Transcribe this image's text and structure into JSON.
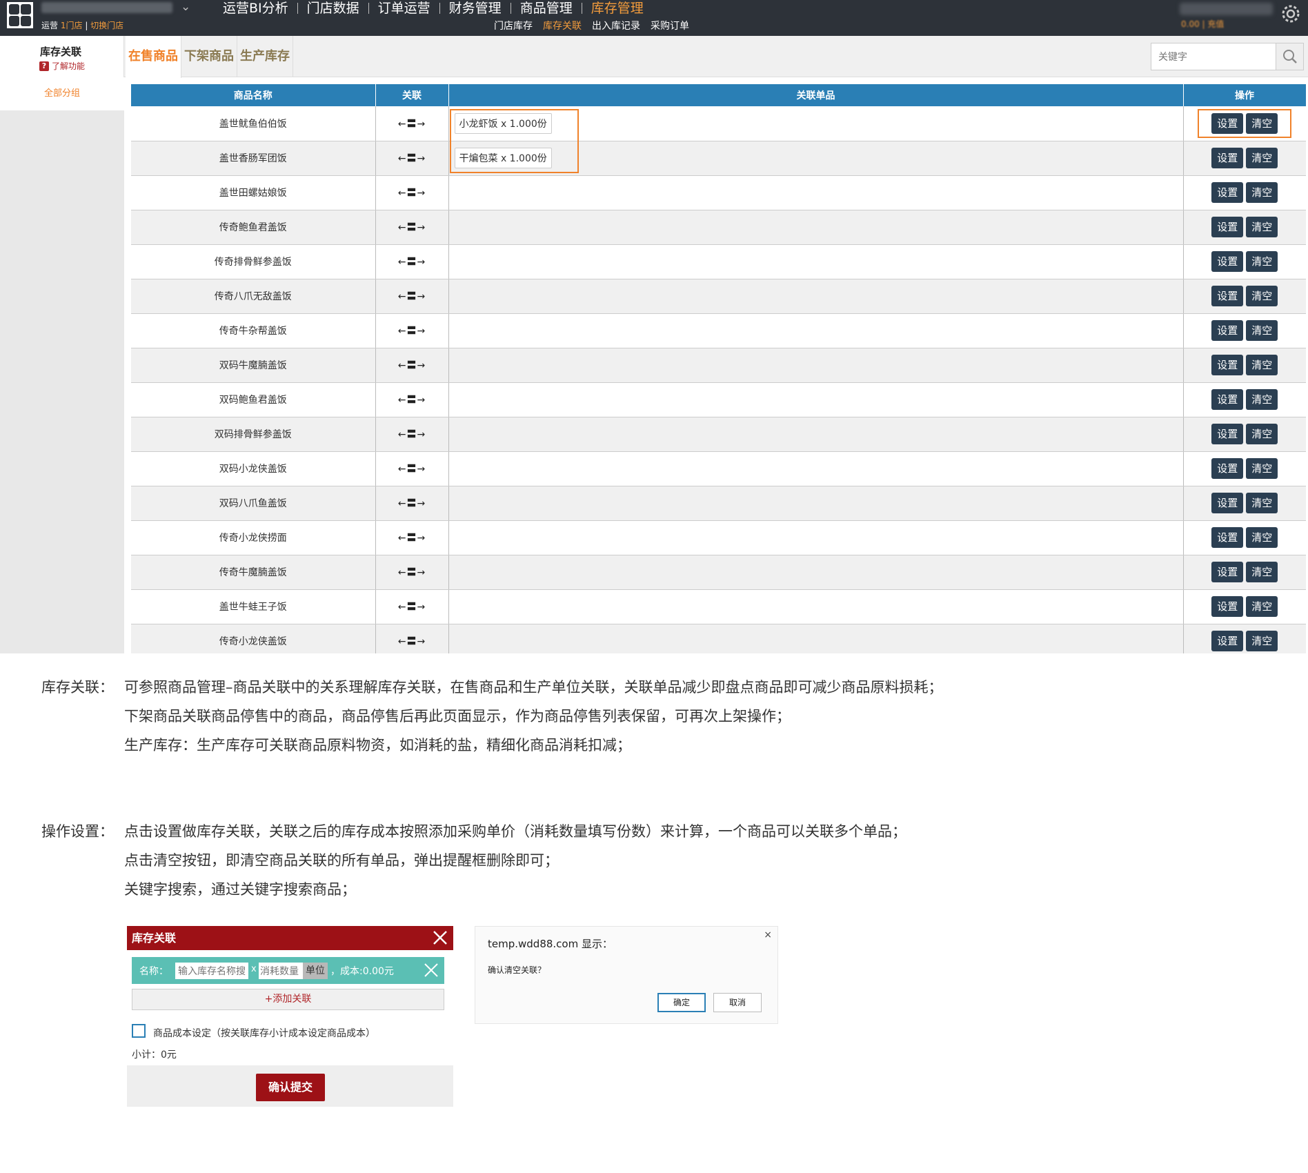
{
  "header": {
    "store_sub": "运营",
    "store_count": "1门店",
    "store_switch": "切换门店",
    "nav": [
      "运营BI分析",
      "门店数据",
      "订单运营",
      "财务管理",
      "商品管理",
      "库存管理"
    ],
    "nav_active": 5,
    "subnav": [
      "门店库存",
      "库存关联",
      "出入库记录",
      "采购订单"
    ],
    "subnav_active": 1,
    "user_sub": "0.00 | 充值"
  },
  "sidebar": {
    "title": "库存关联",
    "help": "了解功能",
    "all_groups": "全部分组"
  },
  "tabs": [
    "在售商品",
    "下架商品",
    "生产库存"
  ],
  "search": {
    "placeholder": "关键字"
  },
  "table": {
    "headers": [
      "商品名称",
      "关联",
      "关联单品",
      "操作"
    ],
    "link_symbol": "←〓→",
    "btn_set": "设置",
    "btn_clear": "清空",
    "rows": [
      {
        "name": "盖世鱿鱼伯伯饭",
        "items": [
          "小龙虾饭 x 1.000份"
        ]
      },
      {
        "name": "盖世香肠军团饭",
        "items": [
          "干煸包菜 x 1.000份"
        ]
      },
      {
        "name": "盖世田螺姑娘饭",
        "items": []
      },
      {
        "name": "传奇鲍鱼君盖饭",
        "items": []
      },
      {
        "name": "传奇排骨鲜参盖饭",
        "items": []
      },
      {
        "name": "传奇八爪无敌盖饭",
        "items": []
      },
      {
        "name": "传奇牛杂帮盖饭",
        "items": []
      },
      {
        "name": "双码牛魔腩盖饭",
        "items": []
      },
      {
        "name": "双码鲍鱼君盖饭",
        "items": []
      },
      {
        "name": "双码排骨鲜参盖饭",
        "items": []
      },
      {
        "name": "双码小龙侠盖饭",
        "items": []
      },
      {
        "name": "双码八爪鱼盖饭",
        "items": []
      },
      {
        "name": "传奇小龙侠捞面",
        "items": []
      },
      {
        "name": "传奇牛魔腩盖饭",
        "items": []
      },
      {
        "name": "盖世牛蛙王子饭",
        "items": []
      },
      {
        "name": "传奇小龙侠盖饭",
        "items": []
      }
    ]
  },
  "notes": {
    "n1_label": "库存关联：",
    "n1_l1": "可参照商品管理–商品关联中的关系理解库存关联，在售商品和生产单位关联，关联单品减少即盘点商品即可减少商品原料损耗；",
    "n1_l2": "下架商品关联商品停售中的商品，商品停售后再此页面显示，作为商品停售列表保留，可再次上架操作；",
    "n1_l3": "生产库存：生产库存可关联商品原料物资，如消耗的盐，精细化商品消耗扣减；",
    "n2_label": "操作设置：",
    "n2_l1": "点击设置做库存关联，关联之后的库存成本按照添加采购单价（消耗数量填写份数）来计算，一个商品可以关联多个单品；",
    "n2_l2": "点击清空按钮，即清空商品关联的所有单品，弹出提醒框删除即可；",
    "n2_l3": "关键字搜索，通过关键字搜索商品；"
  },
  "dialog": {
    "title": "库存关联",
    "name_label": "名称：",
    "name_placeholder": "输入库存名称搜",
    "times": "x",
    "qty_placeholder": "消耗数量",
    "unit": "单位",
    "cost": "，成本:0.00元",
    "add": "+添加关联",
    "checkbox_label": "商品成本设定（按关联库存小计成本设定商品成本）",
    "subtotal": "小计：0元",
    "submit": "确认提交"
  },
  "alert": {
    "title": "temp.wdd88.com 显示：",
    "message": "确认清空关联？",
    "ok": "确定",
    "cancel": "取消",
    "close": "×"
  },
  "colors": {
    "accent": "#f0822a",
    "topbar": "#2d3239",
    "table_header": "#2a7fb5",
    "dialog_red": "#9d1116"
  }
}
